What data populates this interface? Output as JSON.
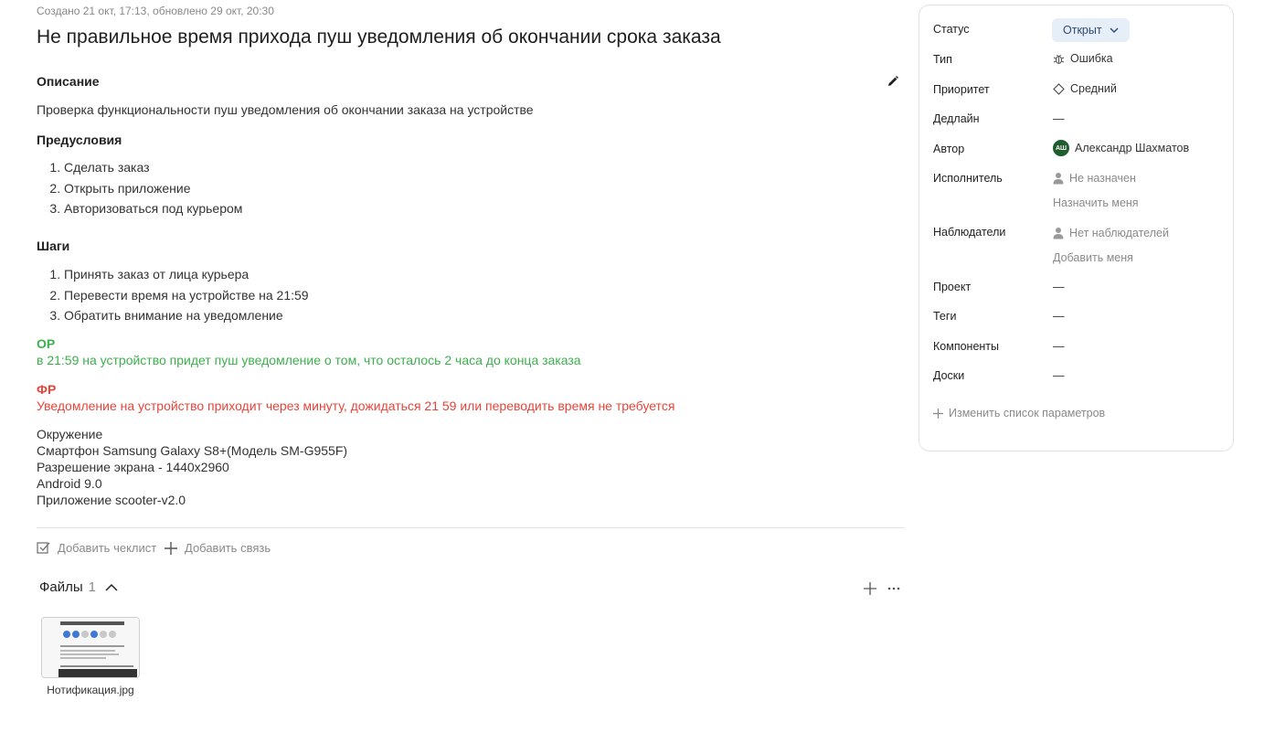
{
  "issue": {
    "meta": "Создано 21 окт, 17:13, обновлено 29 окт, 20:30",
    "title": "Не правильное время прихода пуш уведомления об окончании срока заказа"
  },
  "description": {
    "heading": "Описание",
    "text": "Проверка функциональности пуш уведомления об окончании заказа на устройстве",
    "preconditions_heading": "Предусловия",
    "preconditions": [
      "Сделать заказ",
      "Открыть приложение",
      "Авторизоваться под курьером"
    ],
    "steps_heading": "Шаги",
    "steps": [
      "Принять заказ от лица курьера",
      "Перевести время на устройстве на 21:59",
      "Обратить внимание на уведомление"
    ],
    "expected_heading": "ОР",
    "expected_text": "в 21:59 на устройство придет пуш уведомление о том, что осталось 2 часа до конца заказа",
    "actual_heading": "ФР",
    "actual_text": "Уведомление на устройство приходит через минуту, дожидаться 21 59 или переводить время не требуется",
    "environment": [
      "Окружение",
      "Смартфон Samsung Galaxy S8+(Модель SM-G955F)",
      "Разрешение экрана - 1440х2960",
      "Android 9.0",
      "Приложение scooter-v2.0"
    ]
  },
  "actions": {
    "add_checklist": "Добавить чеклист",
    "add_link": "Добавить связь"
  },
  "files": {
    "heading": "Файлы",
    "count": "1",
    "items": [
      {
        "name": "Нотификация.jpg",
        "icon": "image-thumbnail"
      }
    ]
  },
  "sidebar": {
    "status_label": "Статус",
    "status_value": "Открыт",
    "type_label": "Тип",
    "type_value": "Ошибка",
    "priority_label": "Приоритет",
    "priority_value": "Средний",
    "deadline_label": "Дедлайн",
    "deadline_value": "—",
    "author_label": "Автор",
    "author_initials": "АШ",
    "author_value": "Александр Шахматов",
    "assignee_label": "Исполнитель",
    "assignee_value": "Не назначен",
    "assign_me": "Назначить меня",
    "watchers_label": "Наблюдатели",
    "watchers_value": "Нет наблюдателей",
    "add_me": "Добавить меня",
    "project_label": "Проект",
    "project_value": "—",
    "tags_label": "Теги",
    "tags_value": "—",
    "components_label": "Компоненты",
    "components_value": "—",
    "boards_label": "Доски",
    "boards_value": "—",
    "edit_params": "Изменить список параметров"
  },
  "colors": {
    "expected": "#3cb04d",
    "actual": "#e8443a",
    "status_bg": "#e6eef8",
    "avatar_bg": "#1f5c2e"
  }
}
